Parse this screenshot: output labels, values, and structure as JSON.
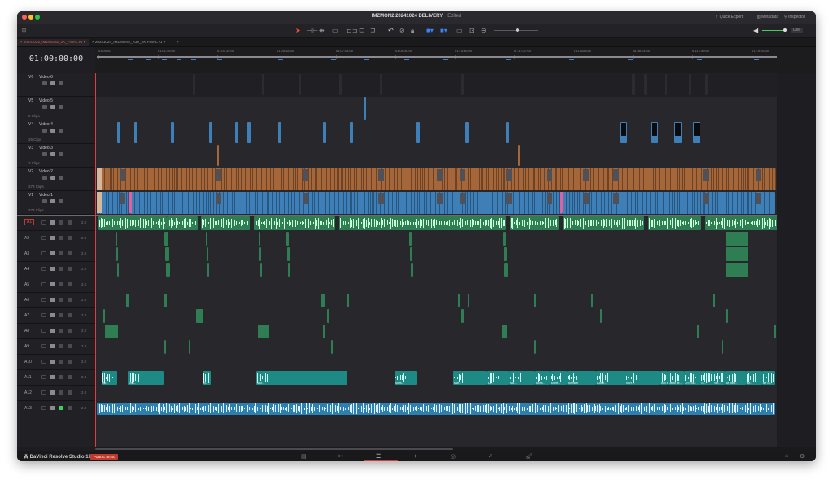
{
  "window": {
    "title": "IMZMON2 20241024 DELIVERY",
    "status": "Edited",
    "right_controls": [
      "Quick Export",
      "Metadata",
      "Inspector"
    ]
  },
  "toolbar": {
    "tools": [
      "select-icon",
      "trim-icon",
      "dynamic-trim-icon",
      "blade-icon",
      "insert-icon",
      "overwrite-icon",
      "replace-icon",
      "snapping-icon",
      "linked-selection-icon",
      "position-lock-icon",
      "flag-icon",
      "marker-icon",
      "zoom-full-icon",
      "zoom-detail-icon",
      "zoom-custom-icon"
    ],
    "volume_label": "DIM"
  },
  "tabs": [
    {
      "label": "20241025_IMZMON2_2K_FINAL.v4",
      "active": true
    },
    {
      "label": "20241024_IMZMON2_R3V_2K FINAL.v1",
      "active": false
    },
    {
      "label": "+",
      "active": false
    }
  ],
  "timecode": "01:00:00:00",
  "ruler_labels": [
    "01:00:00",
    "01:01:46:00",
    "01:03:32:00",
    "01:05:18:00",
    "01:07:04:00",
    "01:08:50:00",
    "01:10:36:00",
    "01:12:22:00",
    "01:14:08:00",
    "01:15:54:00",
    "01:17:40:00",
    "01:19:26:00"
  ],
  "video_tracks": [
    {
      "id": "V6",
      "name": "Video 6",
      "clips": "",
      "color": "#3d3d42"
    },
    {
      "id": "V5",
      "name": "Video 5",
      "clips": "2 Clips",
      "color": "#3f7fb8"
    },
    {
      "id": "V4",
      "name": "Video 4",
      "clips": "26 Clips",
      "color": "#3f7fb8"
    },
    {
      "id": "V3",
      "name": "Video 3",
      "clips": "2 Clips",
      "color": "#a5673a"
    },
    {
      "id": "V2",
      "name": "Video 2",
      "clips": "373 Clips",
      "color": "#a5673a"
    },
    {
      "id": "V1",
      "name": "Video 1",
      "clips": "373 Clips",
      "color": "#3f7fb8"
    }
  ],
  "audio_tracks": [
    {
      "id": "A1",
      "vol": "2.0",
      "selected": true
    },
    {
      "id": "A2",
      "vol": "2.0"
    },
    {
      "id": "A3",
      "vol": "2.0"
    },
    {
      "id": "A4",
      "vol": "2.0"
    },
    {
      "id": "A5",
      "vol": "2.0"
    },
    {
      "id": "A6",
      "vol": "2.0"
    },
    {
      "id": "A7",
      "vol": "2.0"
    },
    {
      "id": "A8",
      "vol": "2.0"
    },
    {
      "id": "A9",
      "vol": "2.0"
    },
    {
      "id": "A10",
      "vol": "2.0"
    },
    {
      "id": "A11",
      "vol": "2.0"
    },
    {
      "id": "A12",
      "vol": "2.0"
    },
    {
      "id": "A13",
      "vol": "2.0",
      "solo": true
    }
  ],
  "a11_clip_labels": [
    "Wi...",
    "shib...",
    "ci...",
    "Mor...",
    "Mors...",
    "Mar...",
    "Dr...",
    "Ma...",
    "Mors...",
    "Borrie...",
    "num self",
    "Dawn...",
    "nuer...",
    "num self",
    "Dawn se...",
    "Jel Pos...",
    "G...",
    "Ver...",
    "Be Birtl...",
    "Be...",
    "Be S...",
    "Yehezkel Kor...",
    "B...",
    "Ye..."
  ],
  "bottom_bar": {
    "app": "DaVinci Resolve Studio 19",
    "badge": "PUBLIC BETA",
    "pages": [
      "media-icon",
      "cut-icon",
      "edit-icon",
      "fusion-icon",
      "color-icon",
      "fairlight-icon",
      "deliver-icon"
    ],
    "active_page": "edit-icon"
  },
  "colors": {
    "video_blue": "#3f7fb8",
    "video_orange": "#a5673a",
    "audio_green": "#2f7d52",
    "audio_teal": "#1e8a86",
    "audio_blue": "#2d7fb0",
    "playhead": "#e33c3c"
  }
}
